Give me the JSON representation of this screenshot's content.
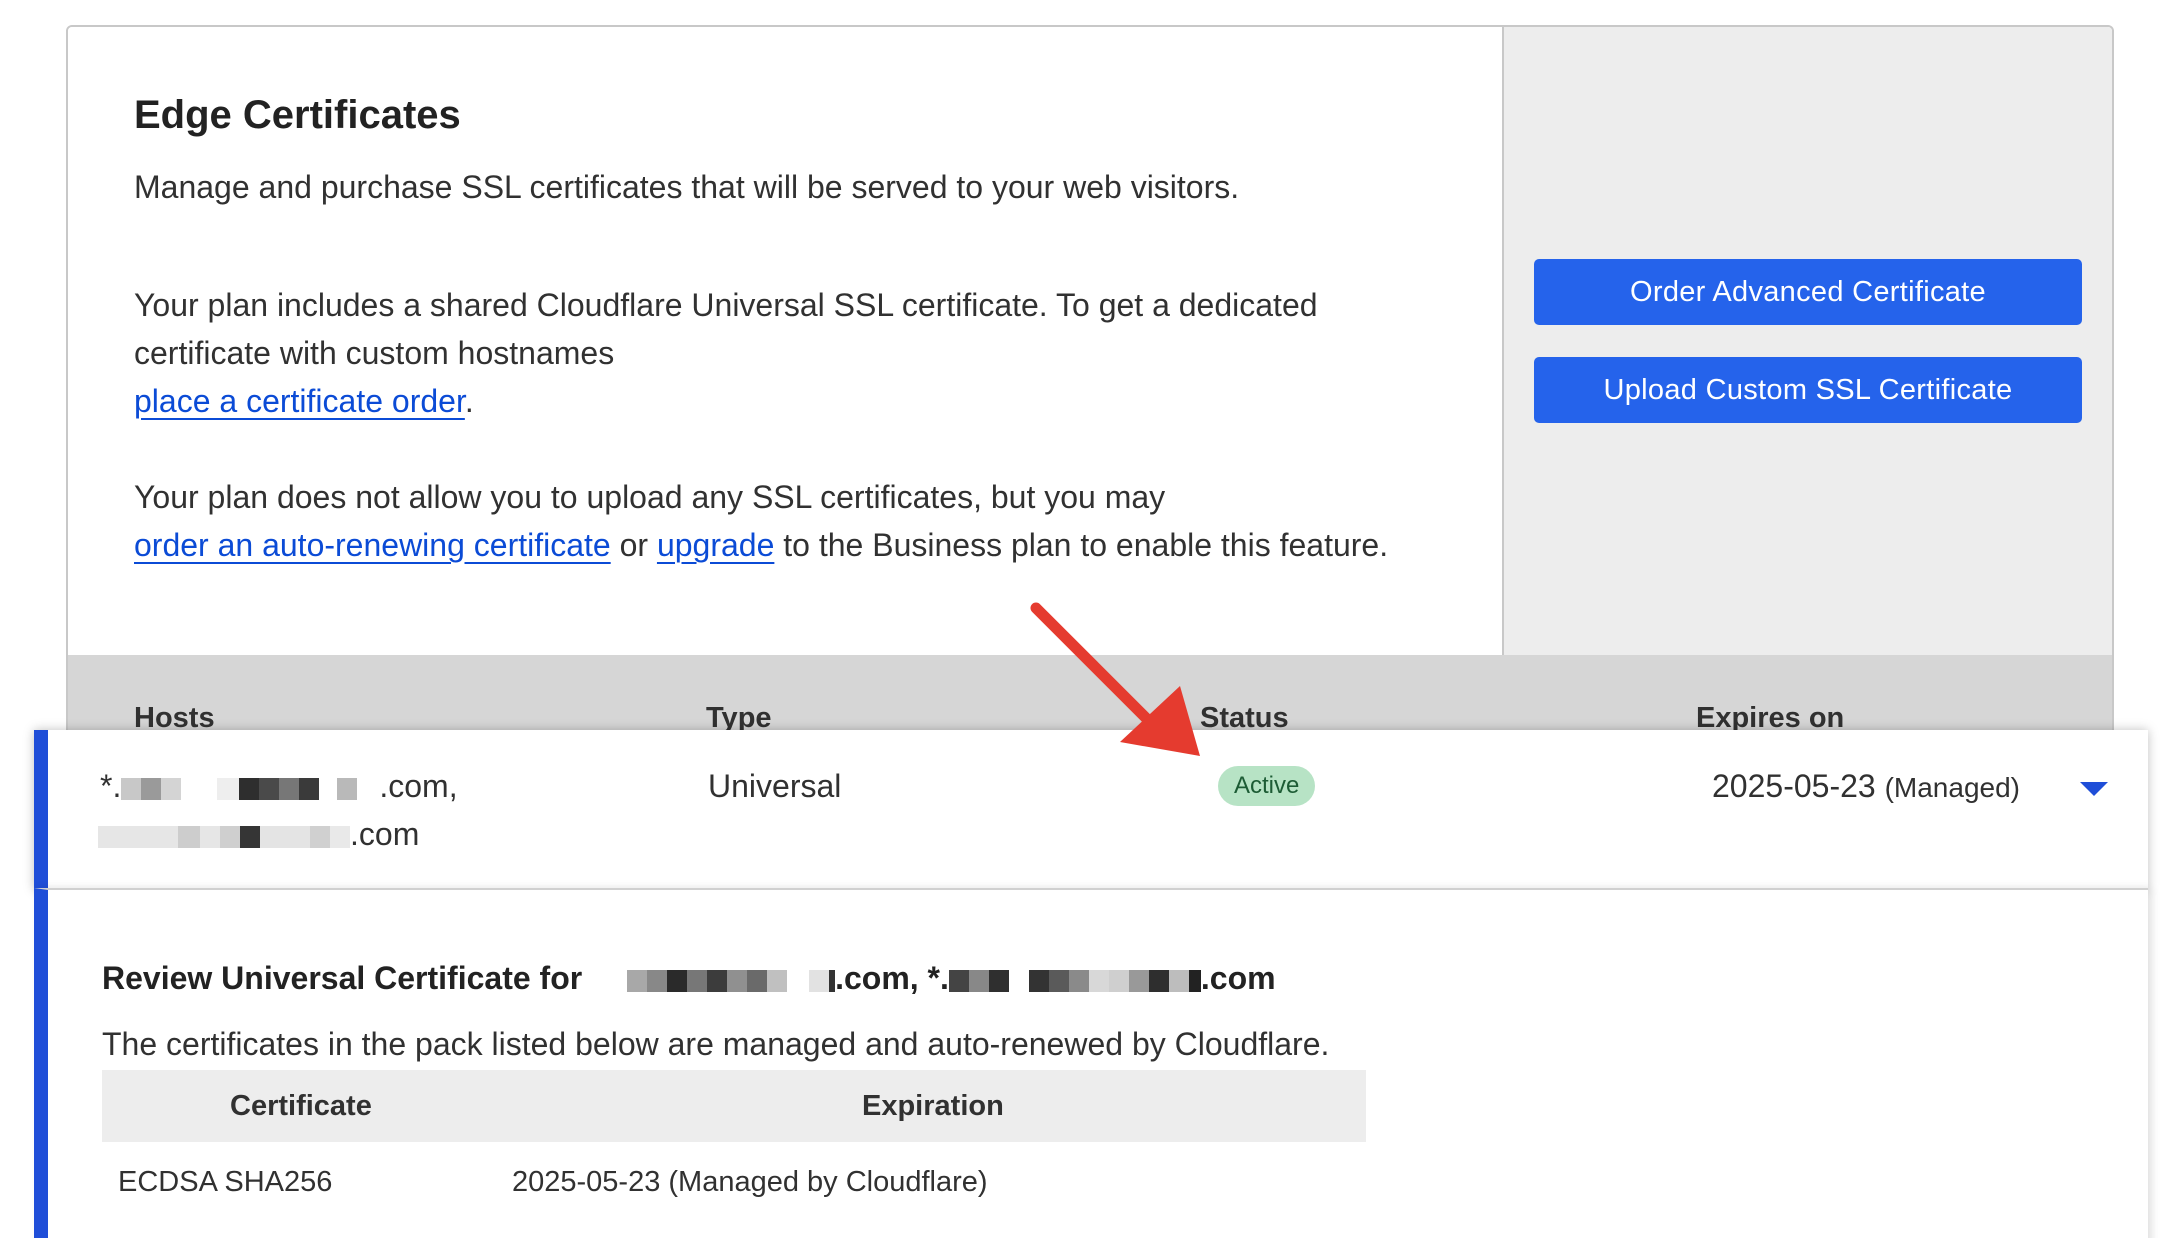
{
  "header": {
    "title": "Edge Certificates",
    "description": "Manage and purchase SSL certificates that will be served to your web visitors."
  },
  "plan_info": {
    "text1": "Your plan includes a shared Cloudflare Universal SSL certificate. To get a dedicated certificate with custom hostnames",
    "link_order": "place a certificate order",
    "period": ".",
    "text2": "Your plan does not allow you to upload any SSL certificates, but you may",
    "link_auto": "order an auto-renewing certificate",
    "or": "or",
    "link_upgrade": "upgrade",
    "text3": "to the Business plan to enable this feature."
  },
  "actions": {
    "order_advanced": "Order Advanced Certificate",
    "upload_custom": "Upload Custom SSL Certificate"
  },
  "table": {
    "columns": [
      "Hosts",
      "Type",
      "Status",
      "Expires on"
    ],
    "row": {
      "host_line1_prefix": "*.",
      "host_line1_suffix": ".com,",
      "host_line2_suffix": ".com",
      "type": "Universal",
      "status": "Active",
      "expires": "2025-05-23",
      "expires_note": "(Managed)"
    }
  },
  "details": {
    "title_prefix": "Review Universal Certificate for",
    "title_mid": ".com, *.",
    "title_suffix": ".com",
    "description": "The certificates in the pack listed below are managed and auto-renewed by Cloudflare.",
    "columns": [
      "Certificate",
      "Expiration"
    ],
    "rows": [
      {
        "certificate": "ECDSA SHA256",
        "expiration": "2025-05-23 (Managed by Cloudflare)"
      }
    ]
  },
  "colors": {
    "accent": "#2563eb",
    "row_highlight": "#1f4ed8",
    "status_active_bg": "#b7e3c5",
    "annotation_arrow": "#e53b2f"
  }
}
